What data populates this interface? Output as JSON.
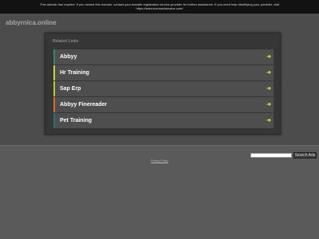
{
  "notice": {
    "line1": "This domain has expired. If you owned this domain, contact your domain registration service provider for further assistance. If you need help identifying your provider, visit",
    "line2": "https://www.tucowsdomains.com/"
  },
  "header": {
    "domain": "abbyrnica.online"
  },
  "panel": {
    "title": "Related Links",
    "links": [
      {
        "label": "Abbyy",
        "accent": "#2f8c6f"
      },
      {
        "label": "Hr Training",
        "accent": "#c9d43a"
      },
      {
        "label": "Sap Erp",
        "accent": "#b6c93a"
      },
      {
        "label": "Abbyy Finereader",
        "accent": "#d96b2a"
      },
      {
        "label": "Pet Training",
        "accent": "#2c6f78"
      }
    ],
    "arrow_icon": "arrow-right-icon",
    "arrow_color": "#c8e04a"
  },
  "search": {
    "input_value": "",
    "button_label": "Search Ads"
  },
  "footer": {
    "privacy_label": "Privacy Policy"
  }
}
